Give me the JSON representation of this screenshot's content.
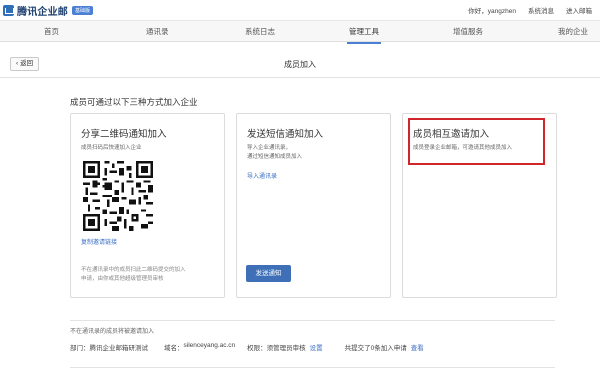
{
  "app": {
    "logo_text": "腾讯企业邮",
    "edition_badge": "基础版"
  },
  "top_links": {
    "greeting": "你好，yangzhen",
    "system_msg": "系统消息",
    "enter_mail": "进入邮箱"
  },
  "nav": {
    "items": [
      {
        "label": "首页"
      },
      {
        "label": "通讯录"
      },
      {
        "label": "系统日志"
      },
      {
        "label": "管理工具"
      },
      {
        "label": "增值服务"
      },
      {
        "label": "我的企业"
      }
    ]
  },
  "header": {
    "back_label": "返回",
    "title": "成员加入"
  },
  "subtitle": "成员可通过以下三种方式加入企业",
  "cards": {
    "qr": {
      "title": "分享二维码通知加入",
      "desc": "成员扫码后快速加入企业",
      "link": "复制邀请链接",
      "note_line1": "不在通讯录中的成员扫此二维码提交的加入",
      "note_line2": "申请，由你或其他超级管理员审核"
    },
    "sms": {
      "title": "发送短信通知加入",
      "desc_line1": "导入企业通讯录，",
      "desc_line2": "通过短信通知成员加入",
      "link": "导入通讯录",
      "button": "发送通知"
    },
    "invite": {
      "title": "成员相互邀请加入",
      "desc": "成员登录企业邮箱，可邀请其他成员加入"
    }
  },
  "footer": {
    "title": "不在通讯录的成员将被邀请加入",
    "dept_label": "部门：",
    "dept_value": "腾讯企业邮箱研测试",
    "domain_label": "域名：",
    "domain_value": "silenceyang.ac.cn",
    "perm_label": "权限：",
    "perm_value": "须管理员审核",
    "perm_link": "设置",
    "pending": "共提交了0条加入申请",
    "view_link": "查看"
  },
  "colors": {
    "accent": "#3e6fb7",
    "highlight": "#d0262b"
  }
}
